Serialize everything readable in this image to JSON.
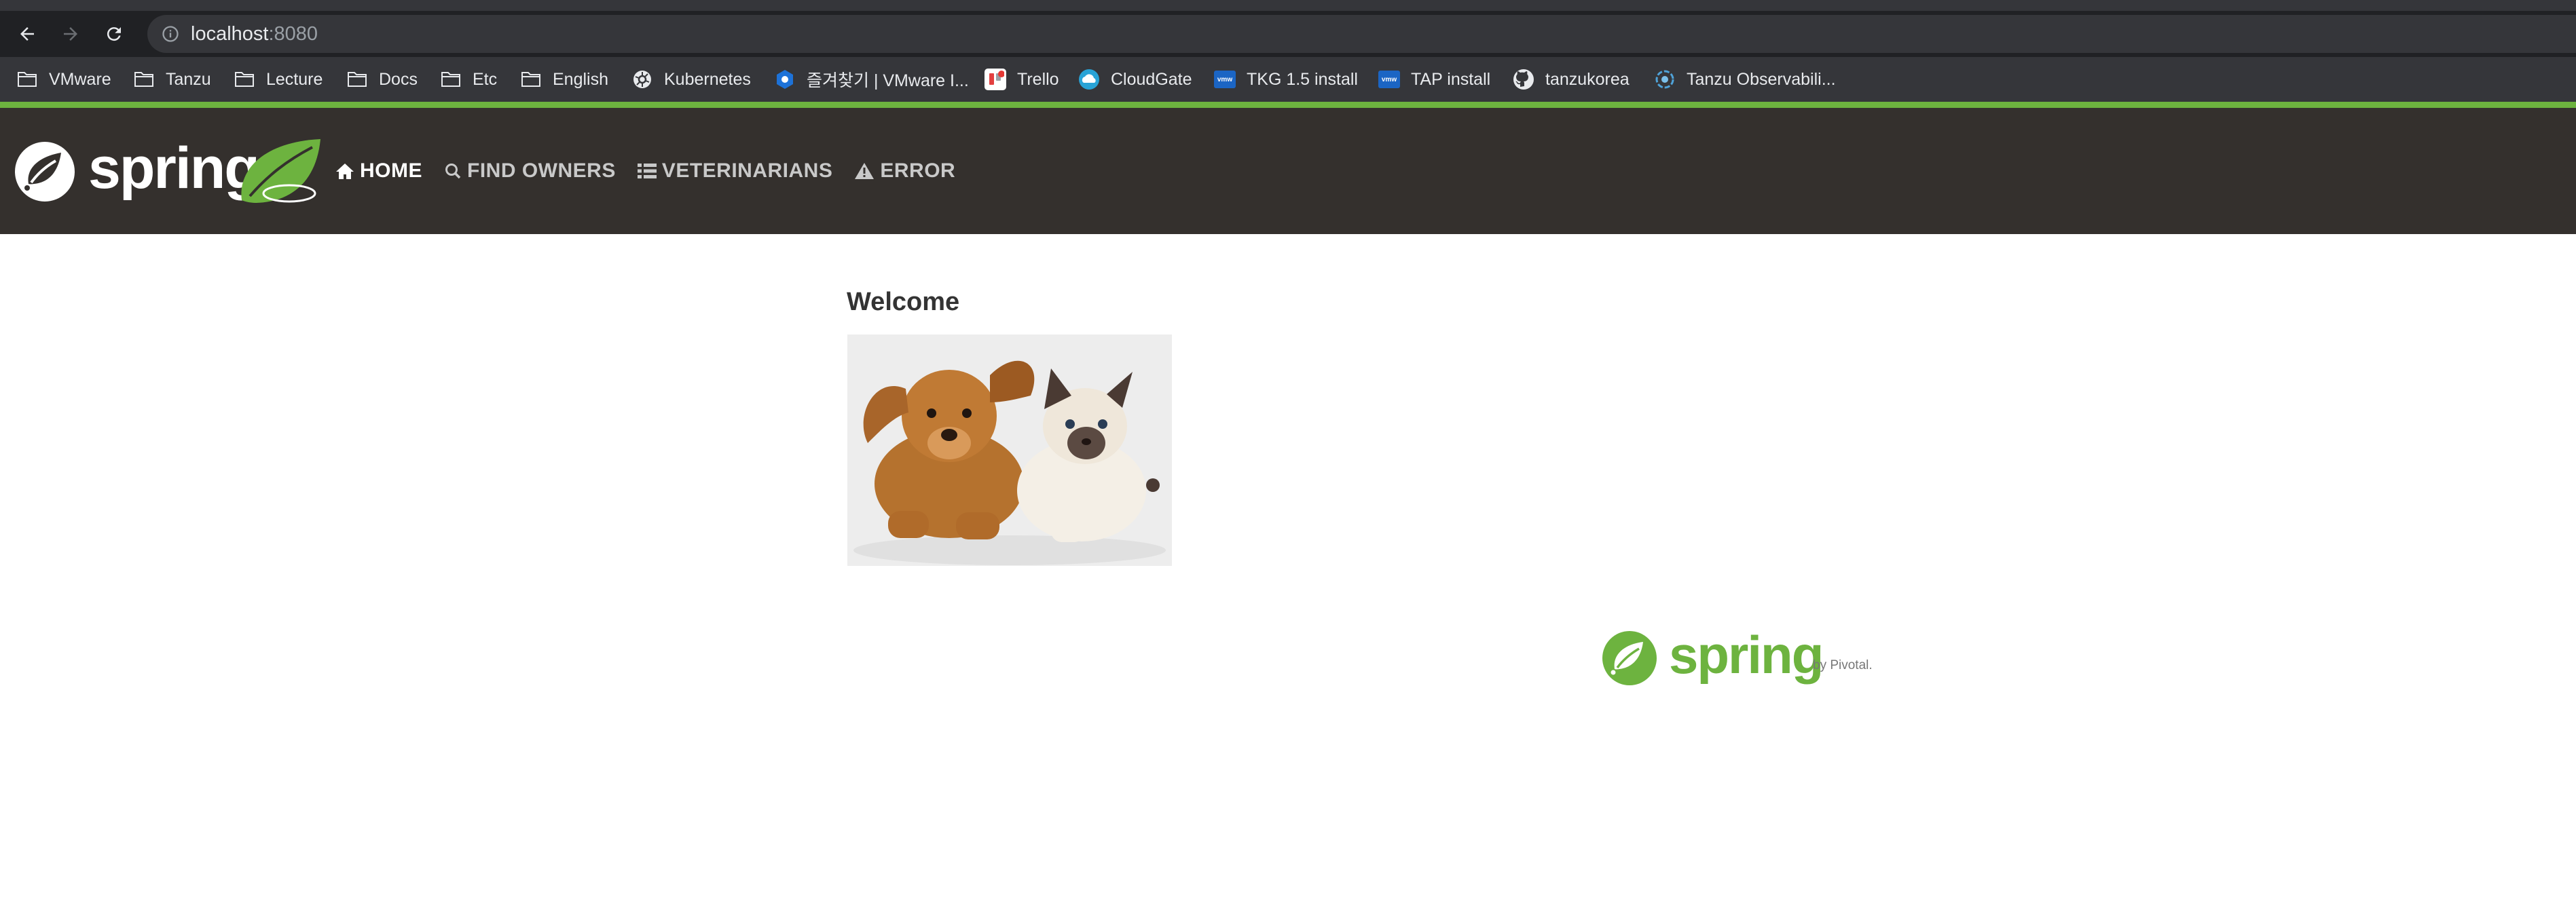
{
  "browser": {
    "url_host": "localhost",
    "url_port": ":8080",
    "bookmarks": [
      {
        "label": "VMware",
        "icon": "folder-icon"
      },
      {
        "label": "Tanzu",
        "icon": "folder-icon"
      },
      {
        "label": "Lecture",
        "icon": "folder-icon"
      },
      {
        "label": "Docs",
        "icon": "folder-icon"
      },
      {
        "label": "Etc",
        "icon": "folder-icon"
      },
      {
        "label": "English",
        "icon": "folder-icon"
      },
      {
        "label": "Kubernetes",
        "icon": "kubernetes-icon"
      },
      {
        "label": "즐겨찾기 | VMware I...",
        "icon": "vmware-icon"
      },
      {
        "label": "Trello",
        "icon": "trello-icon"
      },
      {
        "label": "CloudGate",
        "icon": "cloudgate-icon"
      },
      {
        "label": "TKG 1.5 install",
        "icon": "vmw-icon"
      },
      {
        "label": "TAP install",
        "icon": "vmw-icon"
      },
      {
        "label": "tanzukorea",
        "icon": "github-icon"
      },
      {
        "label": "Tanzu Observabili...",
        "icon": "observability-icon"
      }
    ]
  },
  "navbar": {
    "brand": "spring",
    "items": [
      {
        "label": "HOME",
        "icon": "home-icon",
        "active": true
      },
      {
        "label": "FIND OWNERS",
        "icon": "search-icon",
        "active": false
      },
      {
        "label": "VETERINARIANS",
        "icon": "list-icon",
        "active": false
      },
      {
        "label": "ERROR",
        "icon": "warning-icon",
        "active": false
      }
    ]
  },
  "main": {
    "title": "Welcome"
  },
  "footer": {
    "logo_word": "spring",
    "logo_by": "by Pivotal."
  },
  "colors": {
    "spring_green": "#6db33f",
    "navbar_bg": "#34302d",
    "chrome_bg": "#202124",
    "bookmarks_bg": "#35363a"
  }
}
